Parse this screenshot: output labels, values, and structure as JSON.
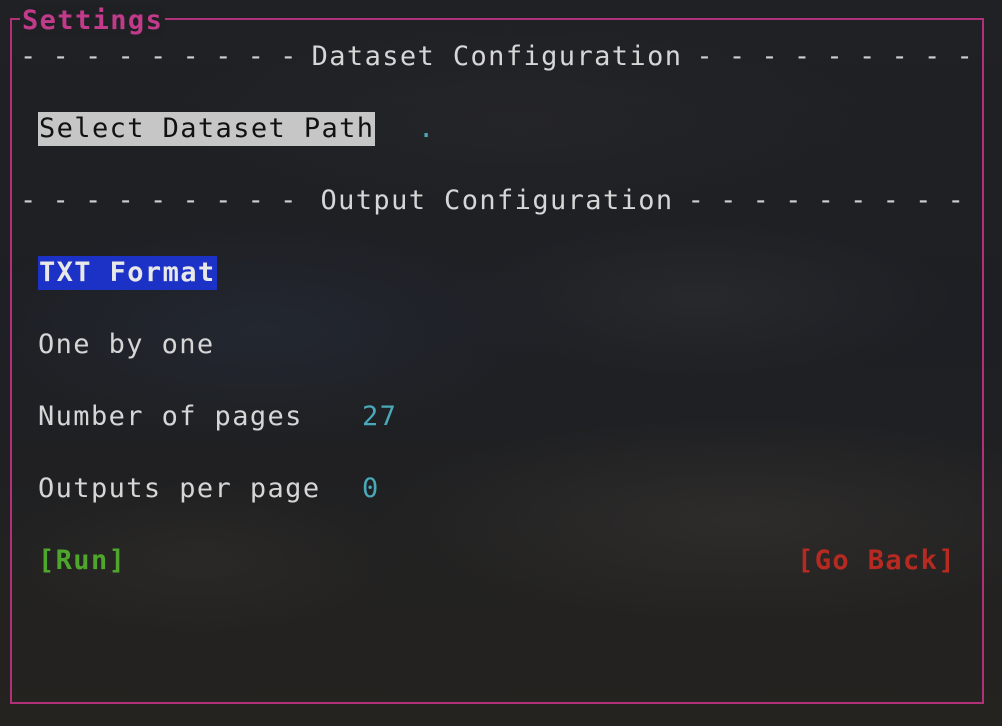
{
  "window": {
    "title": "Settings"
  },
  "sections": {
    "dataset": {
      "title": "Dataset Configuration"
    },
    "output": {
      "title": "Output Configuration"
    }
  },
  "dataset": {
    "select_label": "Select Dataset Path",
    "path_value": "."
  },
  "output": {
    "format_label": "TXT Format",
    "mode_label": "One by one",
    "pages_label": "Number of pages",
    "pages_value": "27",
    "outputs_label": "Outputs per page",
    "outputs_value": "0"
  },
  "actions": {
    "run_label": "[Run]",
    "back_label": "[Go Back]"
  },
  "colors": {
    "border": "#b0307a",
    "title": "#c23a8a",
    "value": "#4aa9b9",
    "selection": "#1c31c6",
    "run": "#4fa62c",
    "back": "#b72a22"
  }
}
